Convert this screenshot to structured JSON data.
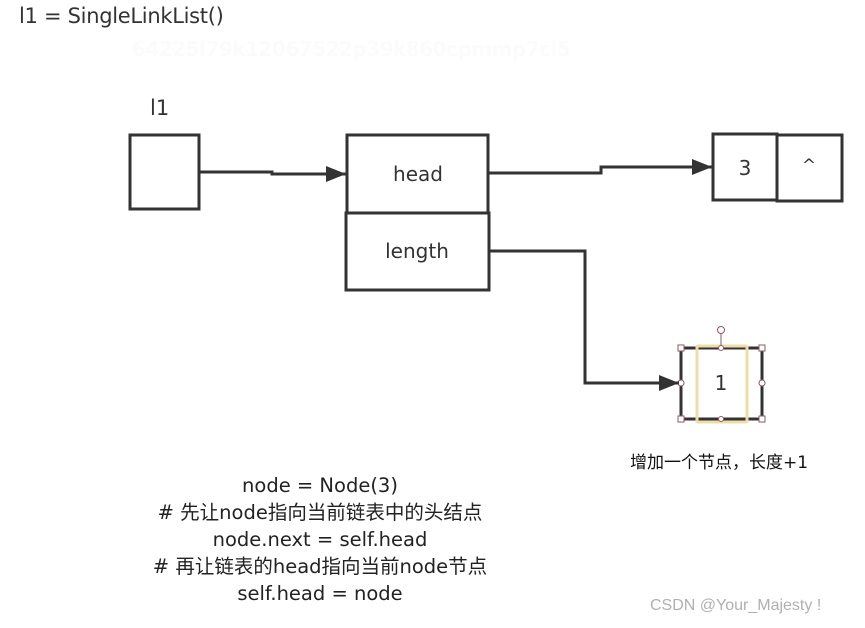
{
  "title": "l1 = SingleLinkList()",
  "watermark": "64225l79k12067522p39k860cpmmp7cl5",
  "diagram": {
    "variable_label": "l1",
    "object_fields": {
      "head": "head",
      "length": "length"
    },
    "node": {
      "value": "3",
      "next": "^"
    },
    "length_value": "1",
    "caption": "增加一个节点，长度+1",
    "colors": {
      "stroke": "#333333",
      "highlight": "#f3e2b3",
      "handle": "#8b5a63"
    }
  },
  "code_lines": [
    "node = Node(3)",
    "# 先让node指向当前链表中的头结点",
    "node.next = self.head",
    "# 再让链表的head指向当前node节点",
    "self.head = node"
  ],
  "credit": "CSDN @Your_Majesty !"
}
